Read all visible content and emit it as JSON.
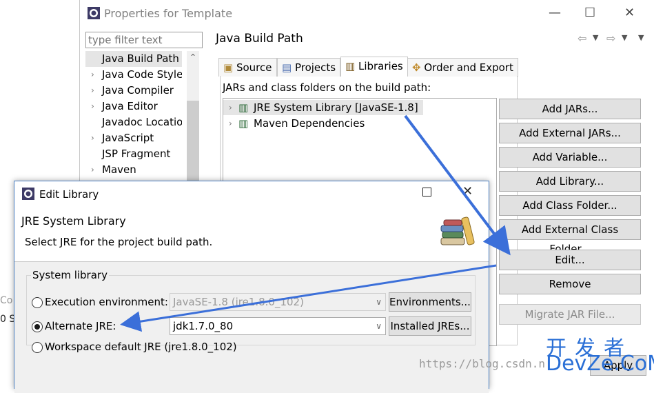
{
  "properties_window": {
    "title": "Properties for Template",
    "minimize": "—",
    "maximize": "☐",
    "close": "✕",
    "filter_placeholder": "type filter text",
    "tree": [
      {
        "label": "Java Build Path",
        "expandable": false,
        "selected": true
      },
      {
        "label": "Java Code Style",
        "expandable": true
      },
      {
        "label": "Java Compiler",
        "expandable": true
      },
      {
        "label": "Java Editor",
        "expandable": true
      },
      {
        "label": "Javadoc Locatior",
        "expandable": false
      },
      {
        "label": "JavaScript",
        "expandable": true
      },
      {
        "label": "JSP Fragment",
        "expandable": false
      },
      {
        "label": "Maven",
        "expandable": true
      }
    ],
    "panel_title": "Java Build Path",
    "tabs": [
      "Source",
      "Projects",
      "Libraries",
      "Order and Export"
    ],
    "active_tab": "Libraries",
    "jars_label": "JARs and class folders on the build path:",
    "libraries": [
      "JRE System Library [JavaSE-1.8]",
      "Maven Dependencies"
    ],
    "buttons": [
      "Add JARs...",
      "Add External JARs...",
      "Add Variable...",
      "Add Library...",
      "Add Class Folder...",
      "Add External Class Folder...",
      "Edit...",
      "Remove",
      "Migrate JAR File..."
    ],
    "bottom_button": "Apply"
  },
  "edit_library_dialog": {
    "title": "Edit Library",
    "heading": "JRE System Library",
    "description": "Select JRE for the project build path.",
    "group_label": "System library",
    "options": [
      {
        "label": "Execution environment:",
        "checked": false,
        "value": "JavaSE-1.8 (jre1.8.0_102)",
        "enabled": false,
        "button": "Environments..."
      },
      {
        "label": "Alternate JRE:",
        "checked": true,
        "value": "jdk1.7.0_80",
        "enabled": true,
        "button": "Installed JREs..."
      },
      {
        "label": "Workspace default JRE (jre1.8.0_102)",
        "checked": false
      }
    ]
  },
  "left_stubs": [
    "Co",
    "0 S"
  ],
  "watermark": {
    "url": "https://blog.csdn.n",
    "cn": "开发者",
    "en": "DevZe.CoM"
  },
  "colors": {
    "arrow": "#3b6fd9",
    "dialog_border": "#4a7fc1",
    "watermark": "#2a6fd6"
  }
}
